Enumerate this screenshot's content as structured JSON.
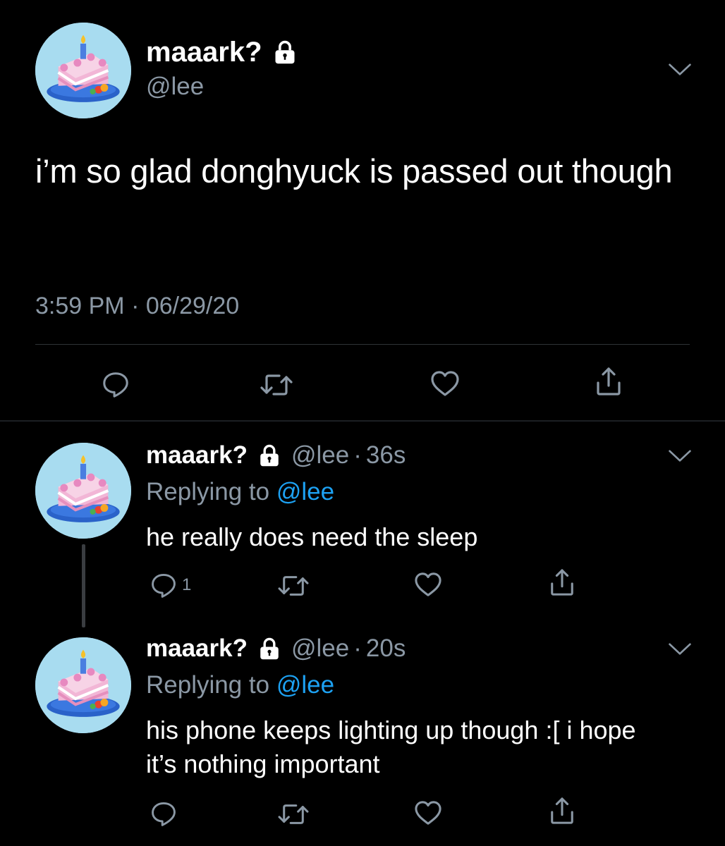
{
  "main_tweet": {
    "display_name": "maaark?",
    "handle": "@lee",
    "text": "i’m so glad donghyuck is passed out though",
    "timestamp": "3:59 PM · 06/29/20",
    "icons": [
      "lock-icon",
      "chevron-down-icon",
      "reply-icon",
      "retweet-icon",
      "like-icon",
      "share-icon"
    ]
  },
  "replies": [
    {
      "display_name": "maaark?",
      "handle": "@lee",
      "dot": "·",
      "age": "36s",
      "replying_prefix": "Replying to ",
      "replying_to": "@lee",
      "text": "he really does need the sleep",
      "reply_count": "1"
    },
    {
      "display_name": "maaark?",
      "handle": "@lee",
      "dot": "·",
      "age": "20s",
      "replying_prefix": "Replying to ",
      "replying_to": "@lee",
      "text": "his phone keeps lighting up though :[ i hope it’s nothing important",
      "reply_count": ""
    }
  ],
  "colors": {
    "background": "#000000",
    "text": "#ffffff",
    "secondary": "#8b98a5",
    "link": "#1da1f2",
    "avatar_bg": "#a8dcf0"
  }
}
